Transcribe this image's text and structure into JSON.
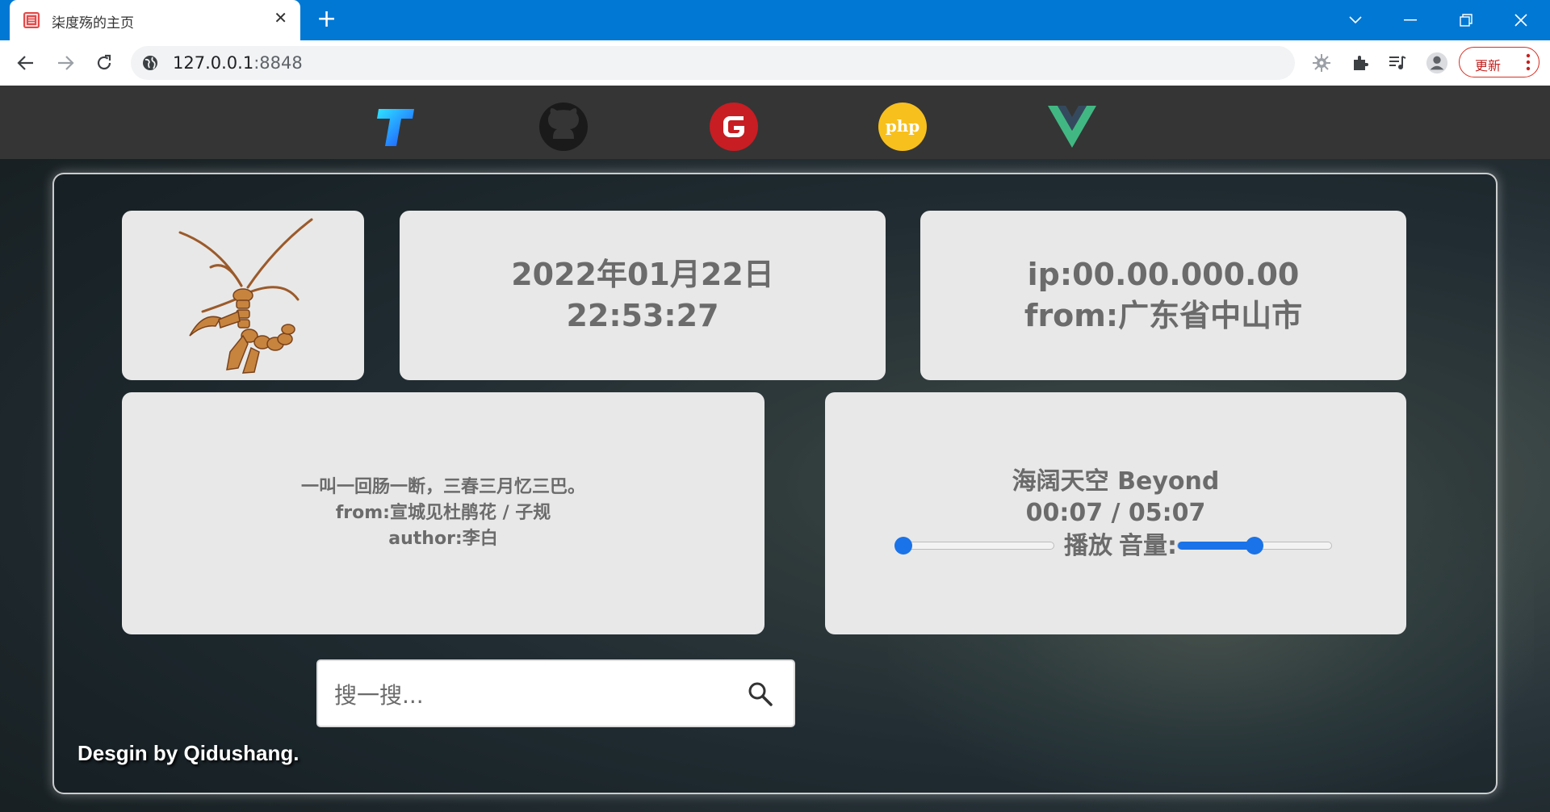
{
  "browser": {
    "tab_title": "柒度殇的主页",
    "url_host": "127.0.0.1",
    "url_port": ":8848",
    "update_label": "更新"
  },
  "nav_links": [
    "typora-icon",
    "github-icon",
    "gitee-icon",
    "php-icon",
    "vue-icon"
  ],
  "cards": {
    "date": "2022年01月22日",
    "time": "22:53:27",
    "ip": "ip:00.00.000.00",
    "from": "from:广东省中山市"
  },
  "poem": {
    "line": "一叫一回肠一断，三春三月忆三巴。",
    "source": "from:宣城见杜鹃花 / 子规",
    "author": "author:李白"
  },
  "music": {
    "title": "海阔天空 Beyond",
    "progress_text": "00:07 / 05:07",
    "play_label": "播放",
    "volume_label": "音量:",
    "progress_fraction": 0.023,
    "volume_fraction": 0.5
  },
  "search": {
    "placeholder": "搜一搜..."
  },
  "footer": {
    "credit": "Desgin by Qidushang."
  },
  "colors": {
    "browser_accent": "#0078d4",
    "slider_blue": "#1a73e8",
    "card_bg": "#e8e8e8",
    "card_text": "#6b6b6b"
  }
}
